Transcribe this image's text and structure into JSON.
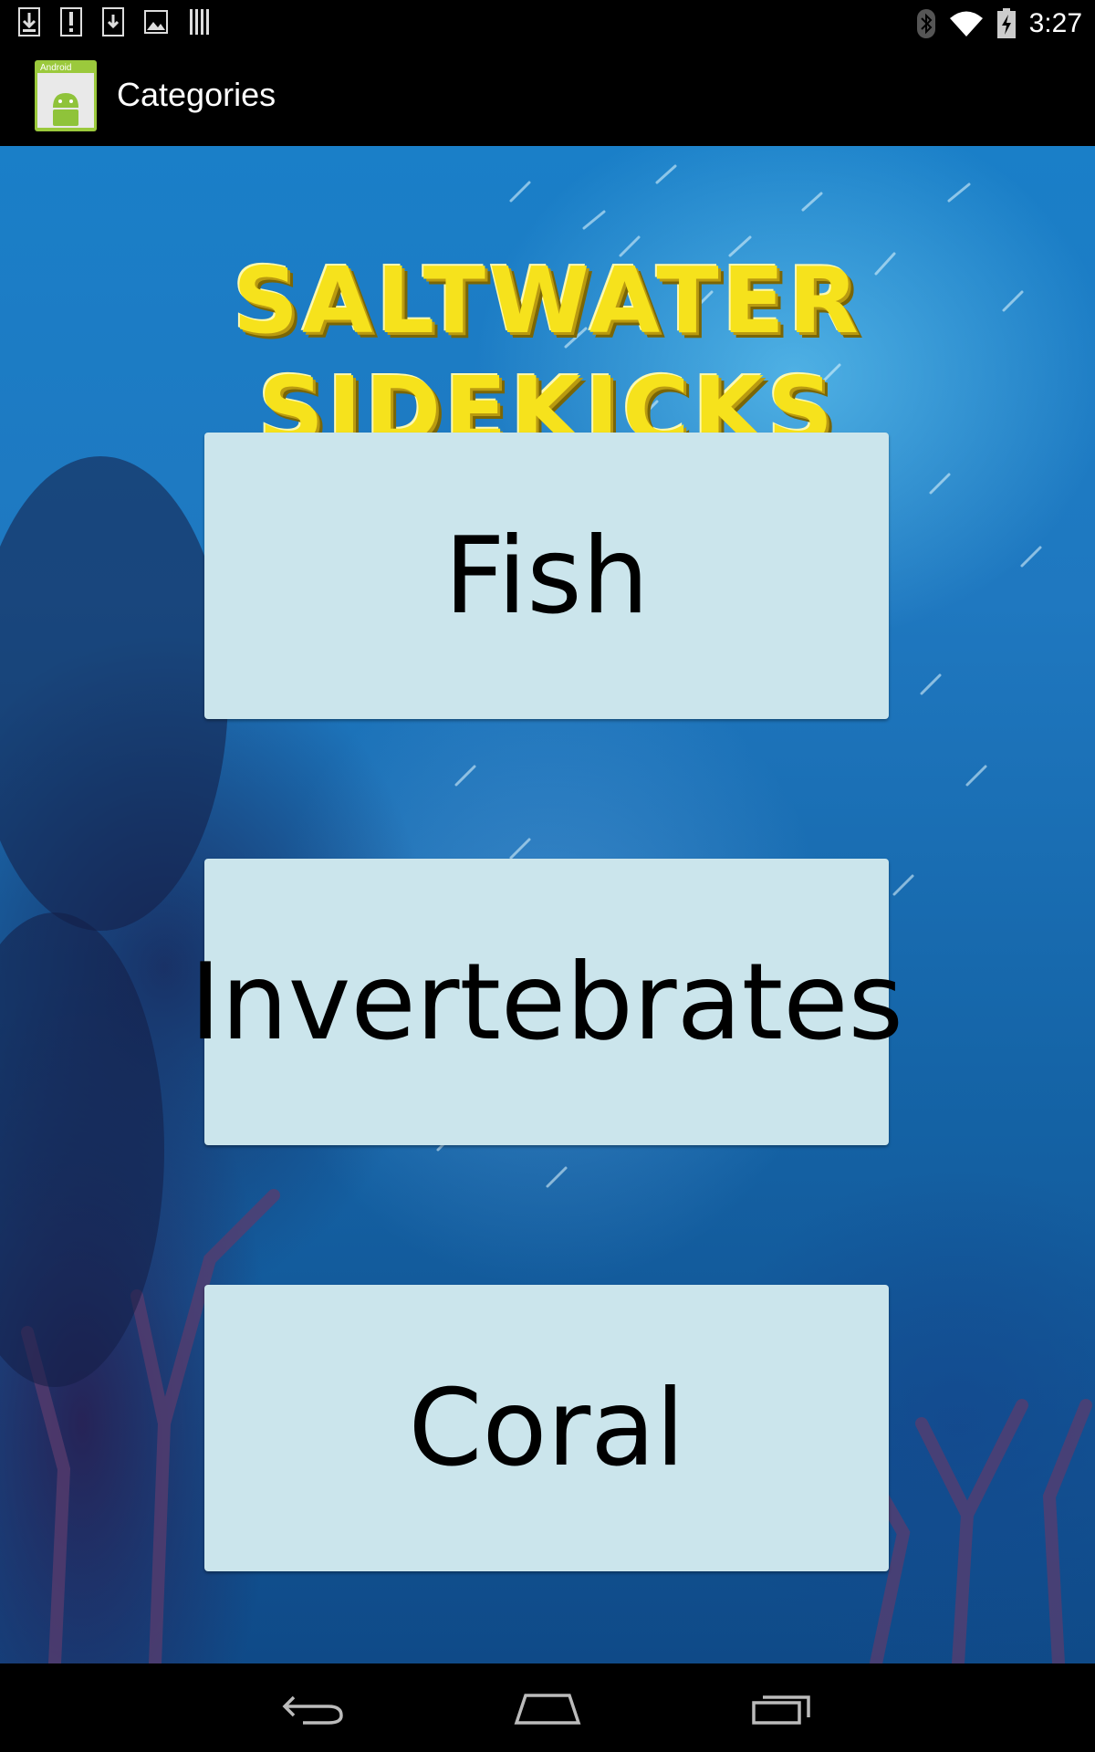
{
  "status_bar": {
    "time": "3:27",
    "left_icons": [
      "download-icon",
      "alert-icon",
      "download-icon",
      "image-icon",
      "barcode-icon"
    ],
    "right_icons": [
      "bluetooth-icon",
      "wifi-icon",
      "battery-charging-icon"
    ]
  },
  "action_bar": {
    "title": "Categories",
    "app_icon": "android-app-icon"
  },
  "content": {
    "banner": "SALTWATER SIDEKICKS",
    "buttons": [
      {
        "label": "Fish"
      },
      {
        "label": "Invertebrates"
      },
      {
        "label": "Coral"
      }
    ],
    "button_color": "#cbe5ec",
    "banner_color": "#f6e21c"
  },
  "nav_bar": {
    "icons": [
      "back-icon",
      "home-icon",
      "recents-icon"
    ]
  }
}
